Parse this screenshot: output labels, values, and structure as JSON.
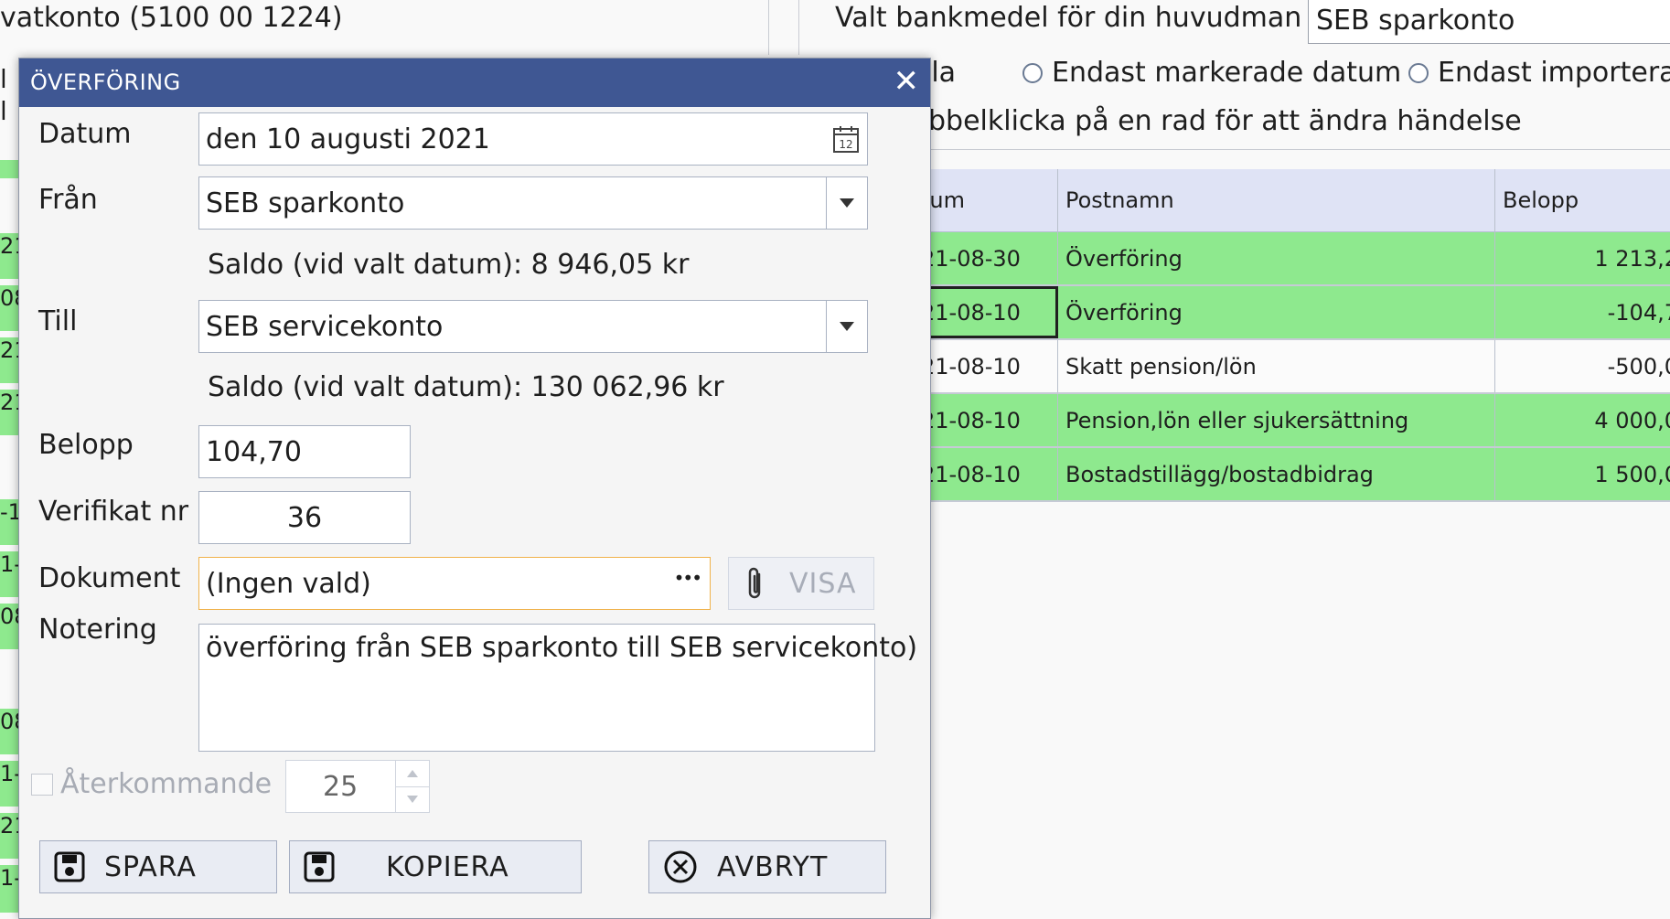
{
  "background": {
    "left_title": "vatkonto (5100 00 1224)",
    "left_fragments": [
      "l",
      "l"
    ],
    "bank_label": "Valt bankmedel för din huvudman",
    "bank_value": "SEB sparkonto",
    "filter_all_fragment": "lla",
    "filter_marked": "Endast markerade datum",
    "filter_imported": "Endast importerad",
    "hint": "bbelklicka på en rad för att ändra händelse",
    "left_dates": [
      "21",
      "08",
      "21",
      "21",
      "-1",
      "1-",
      "08",
      "08",
      "1-",
      "21",
      "1-("
    ],
    "grid": {
      "headers": [
        "tum",
        "Postnamn",
        "Belopp"
      ],
      "rows": [
        {
          "date": "21-08-30",
          "name": "Överföring",
          "amount": "1 213,2",
          "color": "green"
        },
        {
          "date": "21-08-10",
          "name": "Överföring",
          "amount": "-104,7",
          "color": "green"
        },
        {
          "date": "21-08-10",
          "name": "Skatt pension/lön",
          "amount": "-500,0",
          "color": "white"
        },
        {
          "date": "21-08-10",
          "name": "Pension,lön eller sjukersättning",
          "amount": "4 000,0",
          "color": "green"
        },
        {
          "date": "21-08-10",
          "name": "Bostadstillägg/bostadbidrag",
          "amount": "1 500,0",
          "color": "green"
        }
      ]
    }
  },
  "dialog": {
    "title": "ÖVERFÖRING",
    "close_glyph": "✕",
    "datum_label": "Datum",
    "datum_value": "den 10 augusti 2021",
    "fran_label": "Från",
    "fran_value": "SEB sparkonto",
    "fran_saldo": "Saldo (vid valt datum): 8 946,05 kr",
    "till_label": "Till",
    "till_value": "SEB servicekonto",
    "till_saldo": "Saldo (vid valt datum): 130 062,96 kr",
    "belopp_label": "Belopp",
    "belopp_value": "104,70",
    "verifikat_label": "Verifikat nr",
    "verifikat_value": "36",
    "dokument_label": "Dokument",
    "dokument_value": "(Ingen vald)",
    "dokument_browse": "•••",
    "visa_label": "VISA",
    "notering_label": "Notering",
    "notering_value": "överföring från SEB sparkonto till SEB servicekonto)",
    "aterkommande_label": "Återkommande",
    "aterkommande_value": "25",
    "spara_label": "SPARA",
    "kopiera_label": "KOPIERA",
    "avbryt_label": "AVBRYT"
  },
  "colors": {
    "title_bar": "#3f5793",
    "row_green": "#8ee98e",
    "header_blue": "#dfe3f5",
    "doc_border": "#f0b24a"
  }
}
